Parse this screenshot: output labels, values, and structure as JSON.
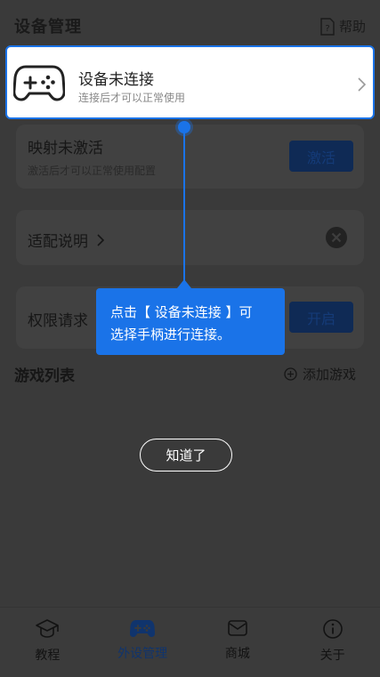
{
  "header": {
    "title": "设备管理",
    "help_label": "帮助"
  },
  "device_card": {
    "title": "设备未连接",
    "subtitle": "连接后才可以正常使用"
  },
  "mapping_card": {
    "title": "映射未激活",
    "subtitle": "激活后才可以正常使用配置",
    "button_label": "激活"
  },
  "adapt_card": {
    "title": "适配说明"
  },
  "permission_card": {
    "title": "权限请求",
    "button_label": "开启"
  },
  "game_list": {
    "title": "游戏列表",
    "add_label": "添加游戏"
  },
  "guide": {
    "tip_line1": "点击【 设备未连接 】可",
    "tip_line2": "选择手柄进行连接。",
    "dismiss_label": "知道了"
  },
  "bottom_nav": {
    "items": [
      {
        "label": "教程",
        "icon": "graduation-cap-icon"
      },
      {
        "label": "外设管理",
        "icon": "gamepad-icon",
        "active": true
      },
      {
        "label": "商城",
        "icon": "mail-icon"
      },
      {
        "label": "关于",
        "icon": "info-icon"
      }
    ]
  },
  "colors": {
    "accent": "#1a73e8",
    "overlay_bg": "#3a3a3a"
  }
}
